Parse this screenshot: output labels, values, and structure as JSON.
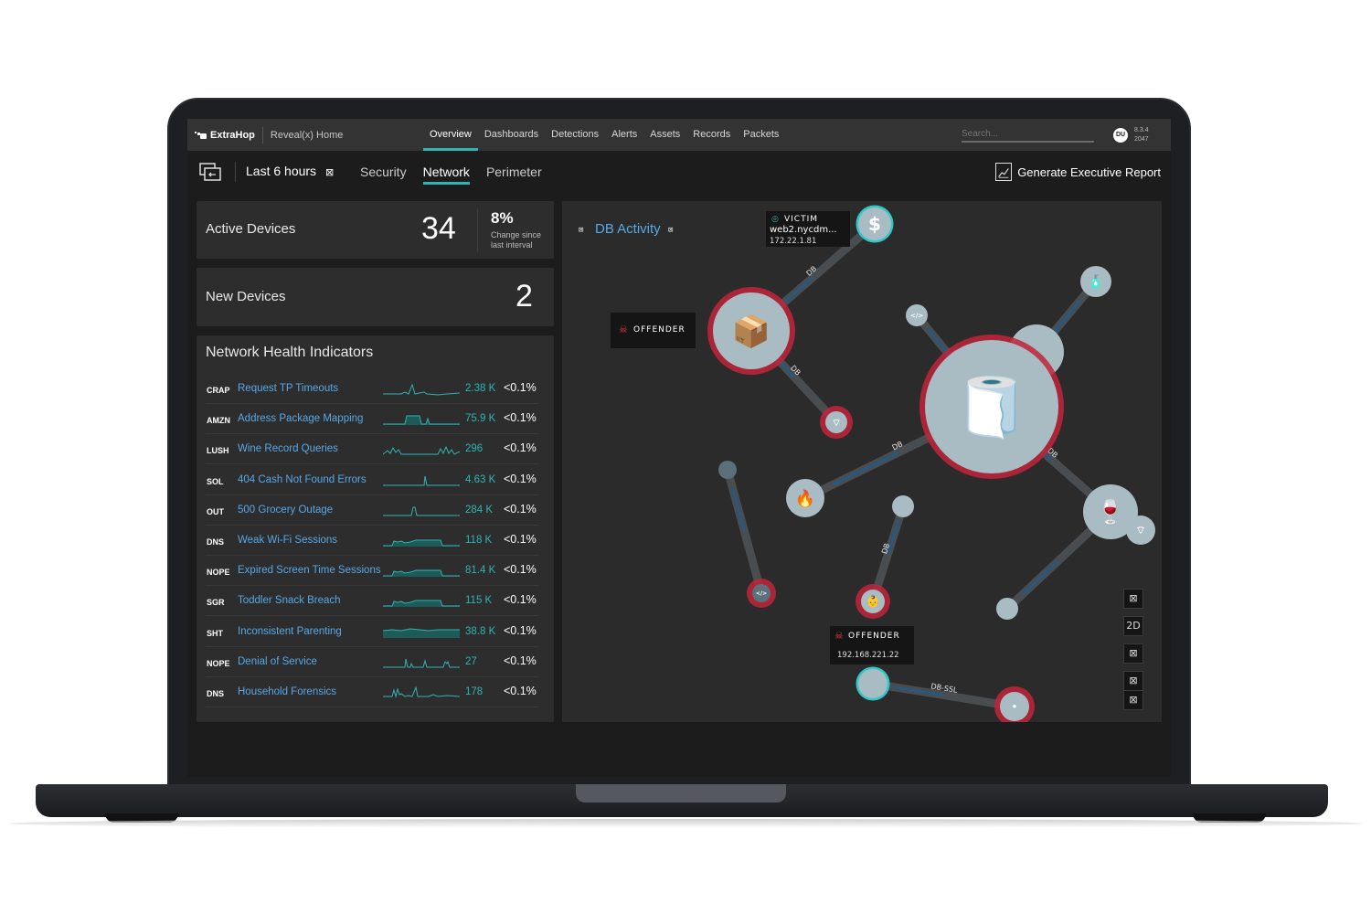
{
  "app": {
    "brand": "ExtraHop",
    "home_label": "Reveal(x) Home",
    "nav": [
      {
        "label": "Overview",
        "active": true
      },
      {
        "label": "Dashboards",
        "active": false
      },
      {
        "label": "Detections",
        "active": false
      },
      {
        "label": "Alerts",
        "active": false
      },
      {
        "label": "Assets",
        "active": false
      },
      {
        "label": "Records",
        "active": false
      },
      {
        "label": "Packets",
        "active": false
      }
    ],
    "search_placeholder": "Search...",
    "user_initials": "DU",
    "version_line1": "8.3.4",
    "version_line2": "2047"
  },
  "subbar": {
    "time_range": "Last 6 hours",
    "time_range_icon": "⊠",
    "tabs": [
      {
        "label": "Security",
        "active": false
      },
      {
        "label": "Network",
        "active": true
      },
      {
        "label": "Perimeter",
        "active": false
      }
    ],
    "report_label": "Generate Executive Report"
  },
  "active_devices": {
    "title": "Active Devices",
    "value": "34",
    "change_pct": "8%",
    "change_label": "Change since last interval"
  },
  "new_devices": {
    "title": "New Devices",
    "value": "2"
  },
  "health": {
    "title": "Network Health Indicators",
    "rows": [
      {
        "tag": "CRAP",
        "name": "Request TP Timeouts",
        "value": "2.38 K",
        "pct": "<0.1%"
      },
      {
        "tag": "AMZN",
        "name": "Address Package Mapping",
        "value": "75.9 K",
        "pct": "<0.1%"
      },
      {
        "tag": "LUSH",
        "name": "Wine Record Queries",
        "value": "296",
        "pct": "<0.1%"
      },
      {
        "tag": "SOL",
        "name": "404 Cash Not Found Errors",
        "value": "4.63 K",
        "pct": "<0.1%"
      },
      {
        "tag": "OUT",
        "name": "500 Grocery Outage",
        "value": "284 K",
        "pct": "<0.1%"
      },
      {
        "tag": "DNS",
        "name": "Weak Wi-Fi Sessions",
        "value": "118 K",
        "pct": "<0.1%"
      },
      {
        "tag": "NOPE",
        "name": "Expired Screen Time Sessions",
        "value": "81.4 K",
        "pct": "<0.1%"
      },
      {
        "tag": "SGR",
        "name": "Toddler Snack Breach",
        "value": "115 K",
        "pct": "<0.1%"
      },
      {
        "tag": "SHT",
        "name": "Inconsistent Parenting",
        "value": "38.8 K",
        "pct": "<0.1%"
      },
      {
        "tag": "NOPE",
        "name": "Denial of Service",
        "value": "27",
        "pct": "<0.1%"
      },
      {
        "tag": "DNS",
        "name": "Household Forensics",
        "value": "178",
        "pct": "<0.1%"
      }
    ]
  },
  "graph": {
    "title": "DB Activity",
    "icon_glyph": "⊠",
    "victim": {
      "label": "VICTIM",
      "host": "web2.nycdm...",
      "ip": "172.22.1.81"
    },
    "offender1": {
      "label": "OFFENDER"
    },
    "offender2": {
      "label": "OFFENDER",
      "ip": "192.168.221.22"
    },
    "edge_labels": [
      "DB",
      "DB",
      "DB",
      "DB",
      "DB",
      "DB",
      "DB",
      "DB-SSL"
    ],
    "controls": [
      "⊠",
      "2D",
      "⊠",
      "⊠",
      "⊠"
    ]
  },
  "colors": {
    "accent_teal": "#2fb5b3",
    "link_blue": "#58a8e6",
    "offender_red": "#c0243a",
    "node_gray": "#a9bcc4"
  }
}
